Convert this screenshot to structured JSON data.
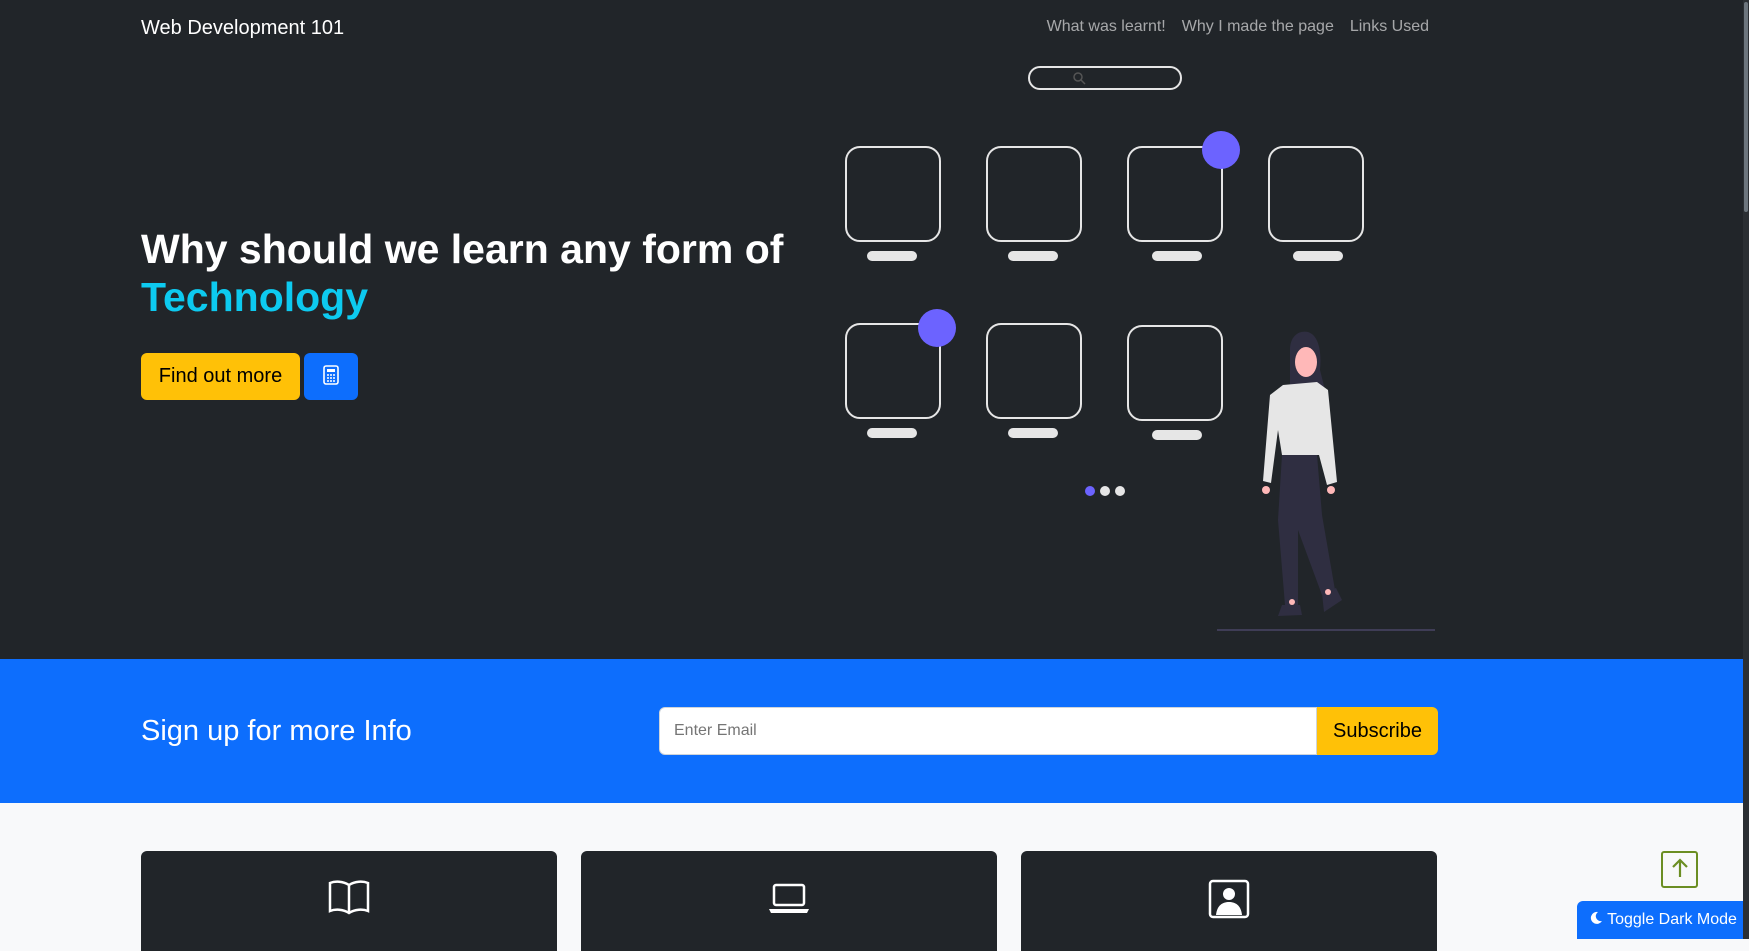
{
  "navbar": {
    "brand": "Web Development 101",
    "links": [
      "What was learnt!",
      "Why I made the page",
      "Links Used"
    ]
  },
  "hero": {
    "title_line1": "Why should we learn any form of",
    "title_accent": "Technology",
    "find_out_more": "Find out more",
    "calculator_icon": "calculator-icon"
  },
  "signup": {
    "title": "Sign up for more Info",
    "email_placeholder": "Enter Email",
    "subscribe_label": "Subscribe"
  },
  "cards": [
    {
      "icon": "book-icon"
    },
    {
      "icon": "laptop-icon"
    },
    {
      "icon": "person-square-icon"
    }
  ],
  "floating": {
    "toggle_dark_mode": "Toggle Dark Mode",
    "scroll_top_icon": "arrow-up-icon"
  },
  "colors": {
    "hero_bg": "#212529",
    "accent_cyan": "#0dcaf0",
    "yellow": "#ffc107",
    "blue": "#0d6efd",
    "illustration_purple": "#6c63ff"
  }
}
